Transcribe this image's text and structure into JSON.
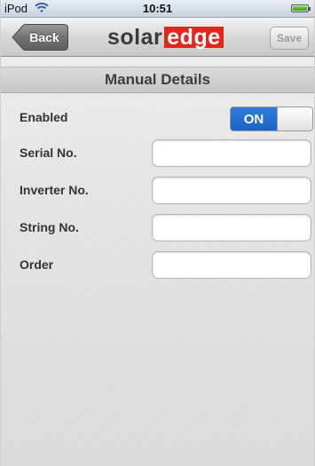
{
  "status_bar": {
    "carrier": "iPod",
    "wifi_icon": "wifi-icon",
    "time": "10:51",
    "battery_icon": "battery-icon",
    "battery_level": 1.0
  },
  "nav": {
    "back_label": "Back",
    "logo_part1": "solar",
    "logo_part2": "edge",
    "save_label": "Save",
    "colors": {
      "logo_red": "#e3261b",
      "toggle_blue": "#1d63c6"
    }
  },
  "page": {
    "title": "Manual Details"
  },
  "form": {
    "enabled_label": "Enabled",
    "enabled_value": "ON",
    "serial_label": "Serial No.",
    "serial_value": "",
    "inverter_label": "Inverter No.",
    "inverter_value": "",
    "string_label": "String No.",
    "string_value": "",
    "order_label": "Order",
    "order_value": ""
  }
}
